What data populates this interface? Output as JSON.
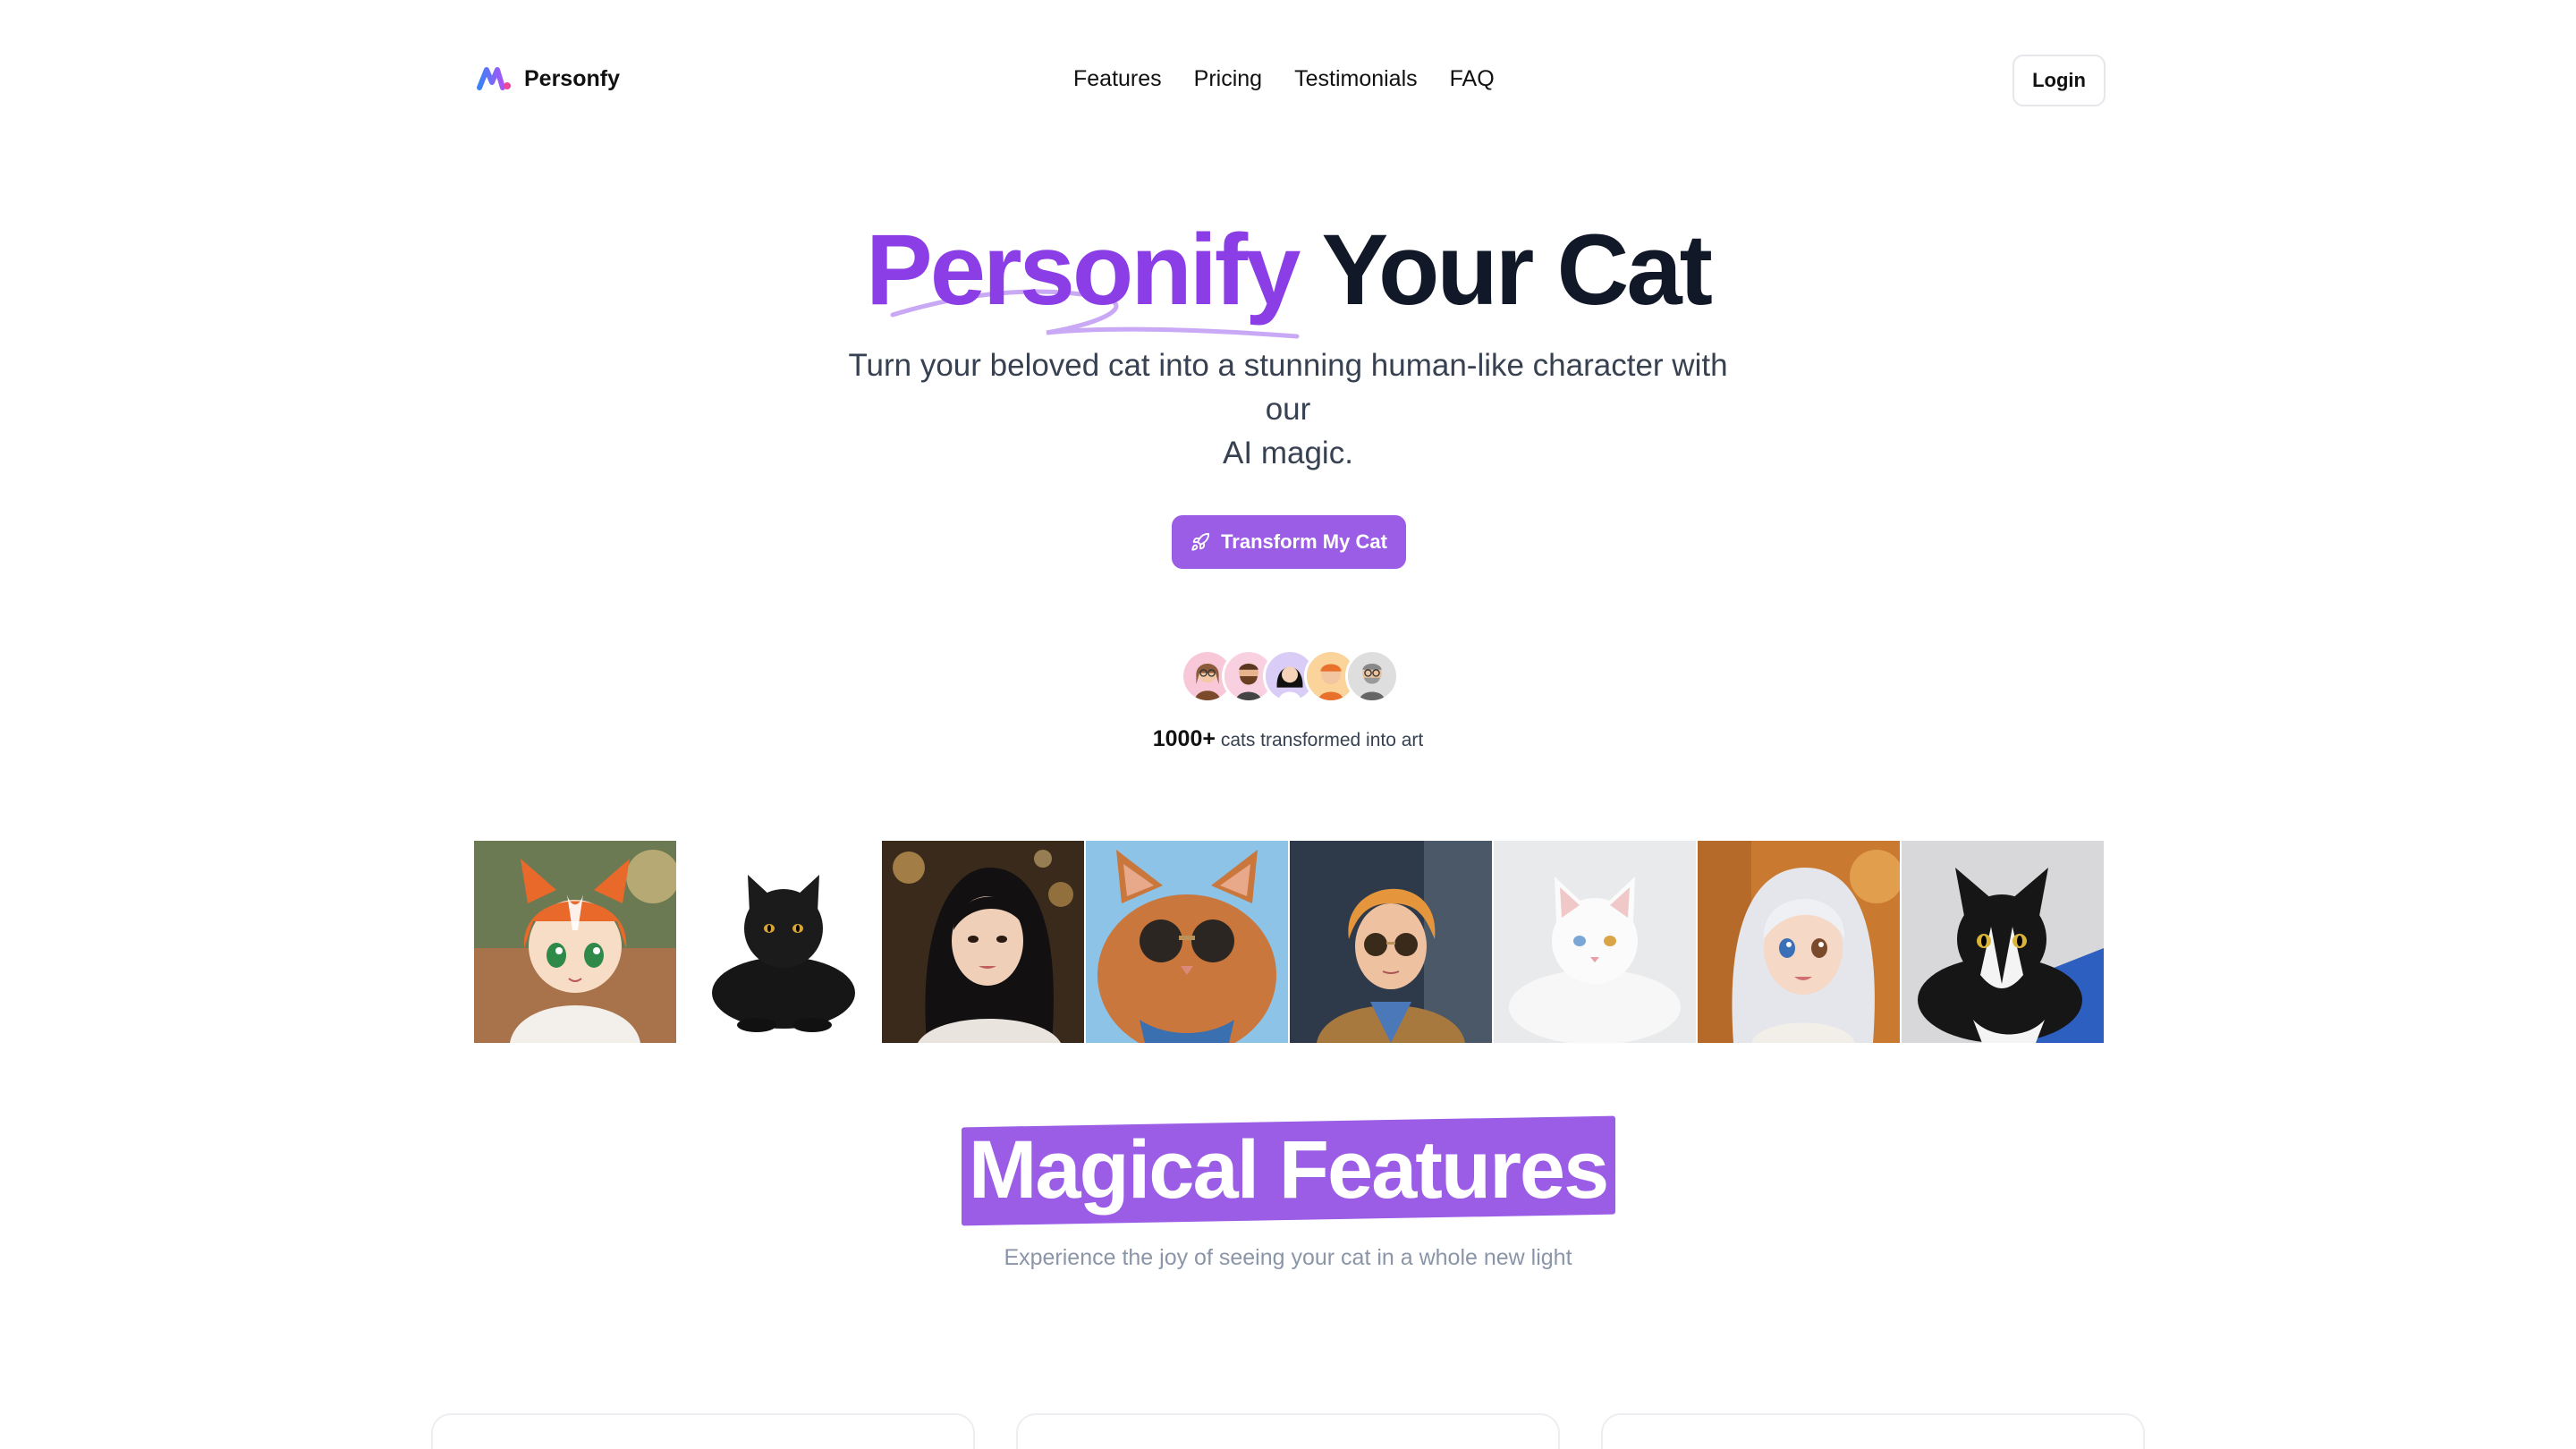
{
  "brand": {
    "name": "Personfy",
    "colors": {
      "accent": "#9b5de5",
      "accent_dark": "#8b3ee6",
      "text": "#111827"
    }
  },
  "nav": {
    "links": [
      "Features",
      "Pricing",
      "Testimonials",
      "FAQ"
    ],
    "login_label": "Login"
  },
  "hero": {
    "title_accent": "Personify",
    "title_rest": "Your Cat",
    "subtitle_line1": "Turn your beloved cat into a stunning human-like character with our",
    "subtitle_line2": "AI magic.",
    "cta_label": "Transform My Cat",
    "cta_icon": "rocket-icon"
  },
  "social_proof": {
    "count": "1000+",
    "text": "cats transformed into art",
    "avatars": [
      "avatar-woman-glasses",
      "avatar-man-beard",
      "avatar-woman-dark-hair",
      "avatar-person-orange",
      "avatar-man-gray"
    ]
  },
  "gallery": [
    "anime-cat-girl",
    "black-cat",
    "woman-portrait",
    "cat-with-sunglasses",
    "boy-with-sunglasses",
    "white-cat",
    "white-haired-girl",
    "tuxedo-cat"
  ],
  "features": {
    "title": "Magical Features",
    "subtitle": "Experience the joy of seeing your cat in a whole new light"
  }
}
